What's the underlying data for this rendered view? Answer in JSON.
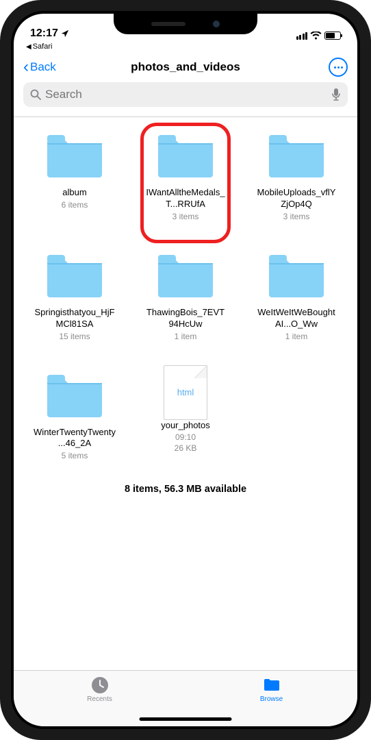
{
  "status_bar": {
    "time": "12:17",
    "breadcrumb_app": "Safari"
  },
  "nav": {
    "back_label": "Back",
    "title": "photos_and_videos"
  },
  "search": {
    "placeholder": "Search"
  },
  "items": [
    {
      "type": "folder",
      "name": "album",
      "sub": "6 items",
      "highlight": false
    },
    {
      "type": "folder",
      "name": "IWantAlltheMedals_T...RRUfA",
      "sub": "3 items",
      "highlight": true
    },
    {
      "type": "folder",
      "name": "MobileUploads_vflYZjOp4Q",
      "sub": "3 items",
      "highlight": false
    },
    {
      "type": "folder",
      "name": "Springisthatyou_HjFMCl81SA",
      "sub": "15 items",
      "highlight": false
    },
    {
      "type": "folder",
      "name": "ThawingBois_7EVT94HcUw",
      "sub": "1 item",
      "highlight": false
    },
    {
      "type": "folder",
      "name": "WeItWeItWeBoughtAI...O_Ww",
      "sub": "1 item",
      "highlight": false
    },
    {
      "type": "folder",
      "name": "WinterTwentyTwenty...46_2A",
      "sub": "5 items",
      "highlight": false
    },
    {
      "type": "file",
      "name": "your_photos",
      "sub": "09:10",
      "sub2": "26 KB",
      "ext": "html",
      "highlight": false
    }
  ],
  "footer": {
    "status": "8 items, 56.3 MB available"
  },
  "tabs": {
    "recents": "Recents",
    "browse": "Browse"
  }
}
